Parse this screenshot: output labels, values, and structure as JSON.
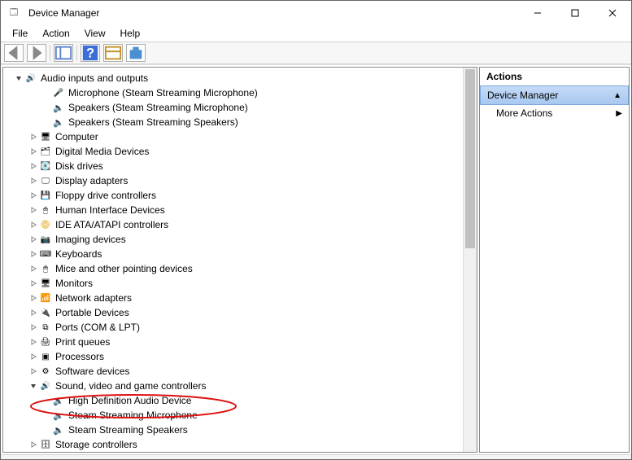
{
  "window": {
    "title": "Device Manager"
  },
  "menu": {
    "file": "File",
    "action": "Action",
    "view": "View",
    "help": "Help"
  },
  "tree": {
    "audio": {
      "label": "Audio inputs and outputs",
      "children": [
        "Microphone (Steam Streaming Microphone)",
        "Speakers (Steam Streaming Microphone)",
        "Speakers (Steam Streaming Speakers)"
      ]
    },
    "computer": "Computer",
    "digitalmedia": "Digital Media Devices",
    "diskdrives": "Disk drives",
    "displayadapters": "Display adapters",
    "floppy": "Floppy drive controllers",
    "hid": "Human Interface Devices",
    "ata": "IDE ATA/ATAPI controllers",
    "imaging": "Imaging devices",
    "keyboards": "Keyboards",
    "mice": "Mice and other pointing devices",
    "monitors": "Monitors",
    "network": "Network adapters",
    "portable": "Portable Devices",
    "ports": "Ports (COM & LPT)",
    "printqueues": "Print queues",
    "processors": "Processors",
    "software": "Software devices",
    "sound": {
      "label": "Sound, video and game controllers",
      "children": [
        "High Definition Audio Device",
        "Steam Streaming Microphone",
        "Steam Streaming Speakers"
      ]
    },
    "storage": "Storage controllers"
  },
  "actions": {
    "header": "Actions",
    "devmgr": "Device Manager",
    "more": "More Actions"
  }
}
